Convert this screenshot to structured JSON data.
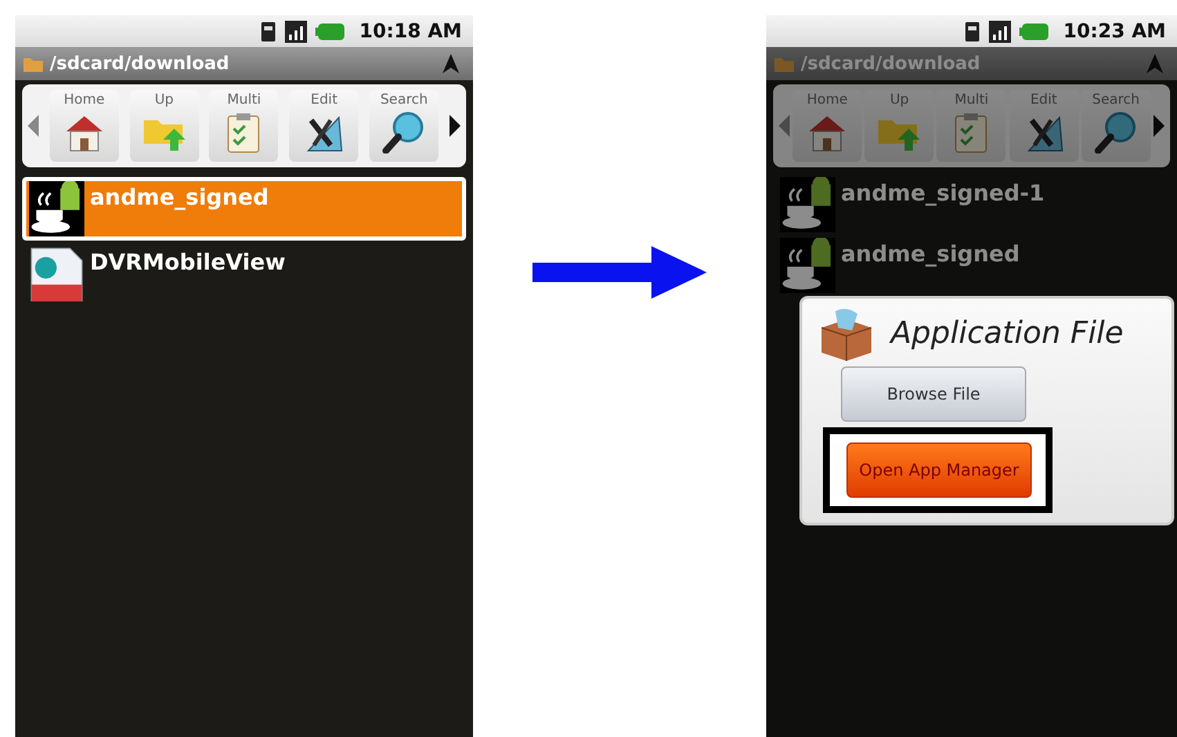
{
  "screens": [
    {
      "status_bar": {
        "time": "10:18 AM"
      },
      "path": "/sdcard/download",
      "dimmed": false,
      "toolbar": [
        {
          "label": "Home",
          "kind": "home"
        },
        {
          "label": "Up",
          "kind": "up"
        },
        {
          "label": "Multi",
          "kind": "multi"
        },
        {
          "label": "Edit",
          "kind": "edit"
        },
        {
          "label": "Search",
          "kind": "search"
        }
      ],
      "files": [
        {
          "name": "andme_signed",
          "kind": "apk",
          "selected": true
        },
        {
          "name": "DVRMobileView",
          "kind": "dvr",
          "selected": false
        }
      ]
    },
    {
      "status_bar": {
        "time": "10:23 AM"
      },
      "path": "/sdcard/download",
      "dimmed": true,
      "toolbar": [
        {
          "label": "Home",
          "kind": "home"
        },
        {
          "label": "Up",
          "kind": "up"
        },
        {
          "label": "Multi",
          "kind": "multi"
        },
        {
          "label": "Edit",
          "kind": "edit"
        },
        {
          "label": "Search",
          "kind": "search"
        }
      ],
      "files": [
        {
          "name": "andme_signed-1",
          "kind": "apk",
          "selected": false
        },
        {
          "name": "andme_signed",
          "kind": "apk",
          "selected": false
        }
      ],
      "dialog": {
        "title": "Application File",
        "buttons": [
          {
            "label": "Browse File",
            "kind": "default",
            "highlighted": false
          },
          {
            "label": "Open App Manager",
            "kind": "primary",
            "highlighted": true
          }
        ]
      }
    }
  ]
}
